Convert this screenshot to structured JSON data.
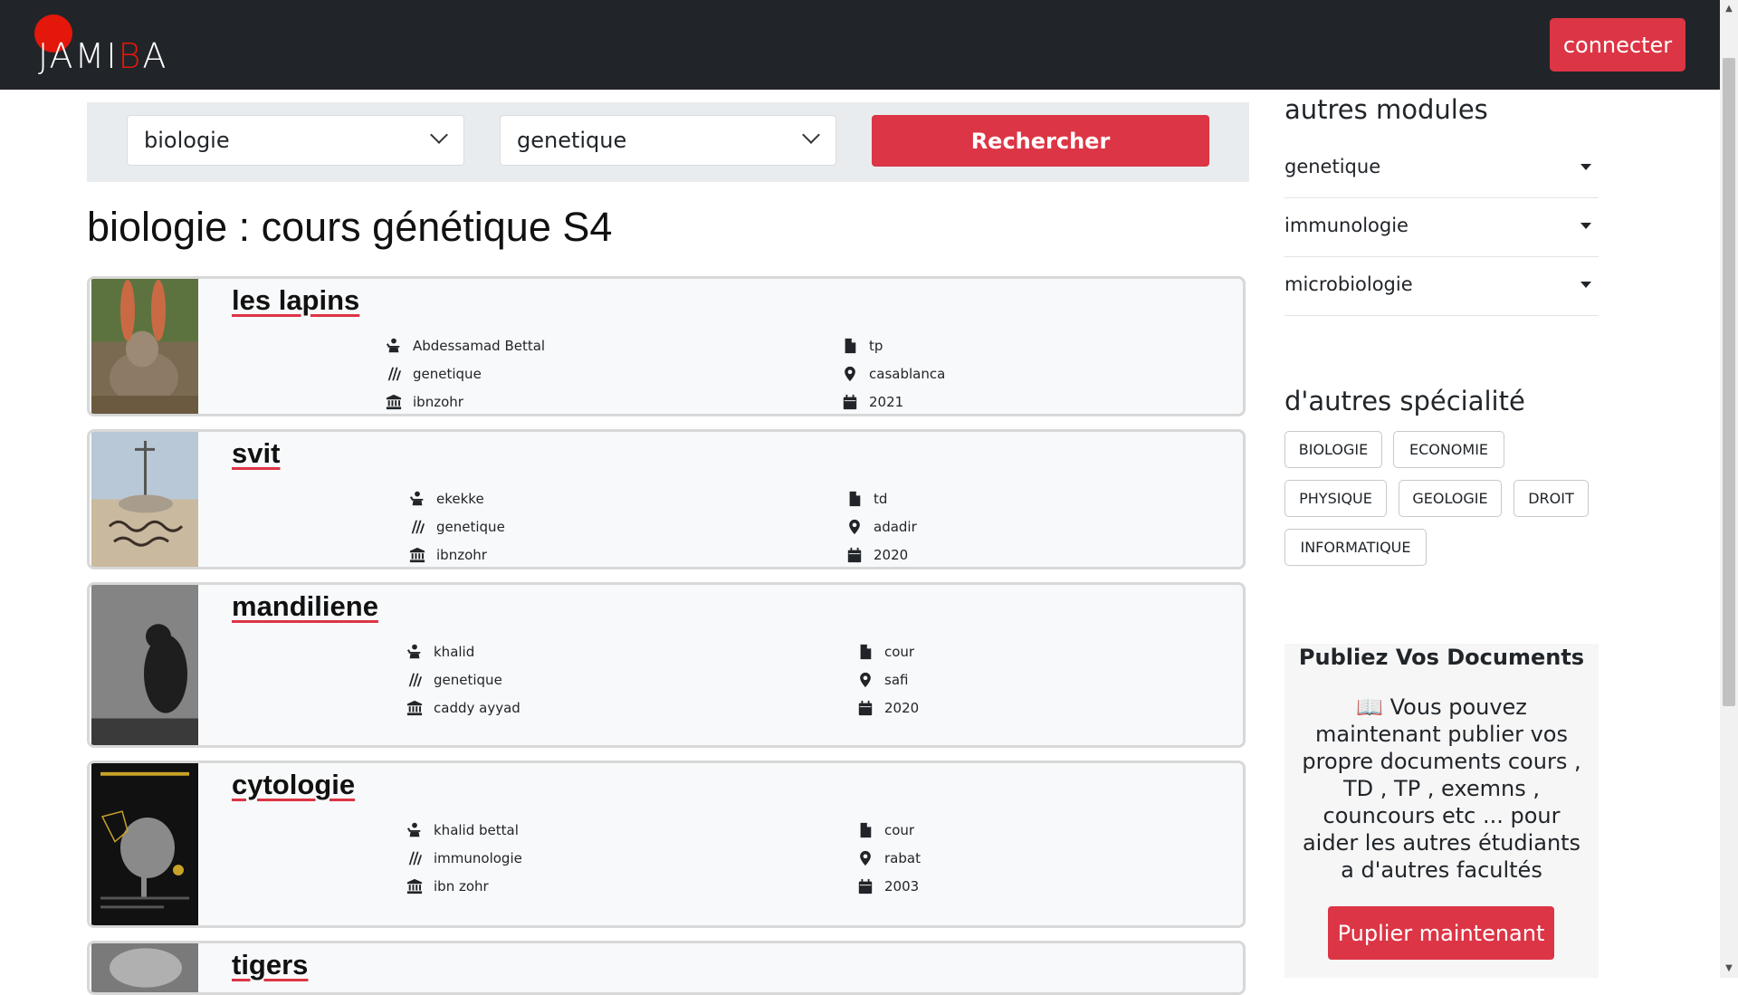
{
  "brand": {
    "name_part1": "JAMI",
    "name_b": "B",
    "name_part2": "A",
    "accent": "#e3170a"
  },
  "nav": {
    "connect_label": "connecter"
  },
  "search": {
    "select1_value": "biologie",
    "select2_value": "genetique",
    "button_label": "Rechercher"
  },
  "page_title": "biologie : cours génétique S4",
  "cards": [
    {
      "title": "les lapins",
      "author": "Abdessamad Bettal",
      "module": "genetique",
      "school": "ibnzohr",
      "type": "tp",
      "city": "casablanca",
      "year": "2021"
    },
    {
      "title": "svit",
      "author": "ekekke",
      "module": "genetique",
      "school": "ibnzohr",
      "type": "td",
      "city": "adadir",
      "year": "2020"
    },
    {
      "title": "mandiliene",
      "author": "khalid",
      "module": "genetique",
      "school": "caddy ayyad",
      "type": "cour",
      "city": "safi",
      "year": "2020"
    },
    {
      "title": "cytologie",
      "author": "khalid bettal",
      "module": "immunologie",
      "school": "ibn zohr",
      "type": "cour",
      "city": "rabat",
      "year": "2003"
    },
    {
      "title": "tigers"
    }
  ],
  "sidebar": {
    "modules_heading": "autres modules",
    "modules": [
      "genetique",
      "immunologie",
      "microbiologie"
    ],
    "specialties_heading": "d'autres spécialité",
    "specialties": [
      "BIOLOGIE",
      "ECONOMIE",
      "PHYSIQUE",
      "GEOLOGIE",
      "DROIT",
      "INFORMATIQUE"
    ],
    "publish": {
      "title": "Publiez Vos Documents",
      "icon": "📖",
      "text": "Vous pouvez maintenant publier vos propre documents cours , TD , TP , exemns , councours etc ... pour aider les autres étudiants a d'autres facultés",
      "button_label": "Puplier maintenant"
    }
  },
  "colors": {
    "primary": "#dc3545",
    "navbar": "#212529"
  }
}
